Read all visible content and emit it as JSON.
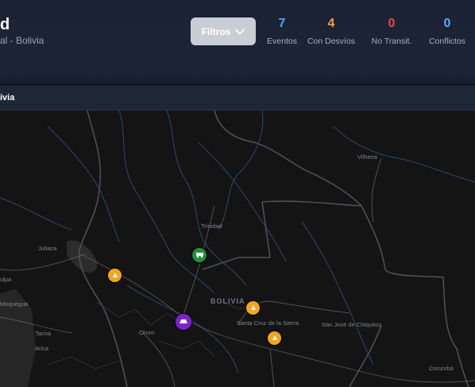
{
  "header": {
    "title_fragment": "d",
    "subtitle_fragment": "al - Bolivia",
    "filter_button": {
      "label": "Filtros",
      "icon": "chevron-down-icon"
    },
    "stats": [
      {
        "value": "7",
        "label": "Eventos",
        "color": "#4aa3ff"
      },
      {
        "value": "4",
        "label": "Con Desvíos",
        "color": "#f59e3b"
      },
      {
        "value": "0",
        "label": "No Transit.",
        "color": "#ef4444"
      },
      {
        "value": "0",
        "label": "Conflictos",
        "color": "#60a5fa"
      }
    ]
  },
  "map_section": {
    "label_fragment": "ivia"
  },
  "map": {
    "places": [
      {
        "name": "Vilhena"
      },
      {
        "name": "Trinidad"
      },
      {
        "name": "Juliaca"
      },
      {
        "name": "ulpa"
      },
      {
        "name": "Moquegua"
      },
      {
        "name": "Tacna"
      },
      {
        "name": "Arica"
      },
      {
        "name": "BOLIVIA"
      },
      {
        "name": "Santa Cruz de la Sierra"
      },
      {
        "name": "San José de Chiquitos"
      },
      {
        "name": "Oruro"
      },
      {
        "name": "Corumbá"
      }
    ],
    "markers": [
      {
        "type": "warning",
        "icon": "detour-icon",
        "color": "#f2a51e"
      },
      {
        "type": "works",
        "icon": "machinery-icon",
        "color": "#1f8f3a"
      },
      {
        "type": "warning",
        "icon": "detour-icon",
        "color": "#f2a51e"
      },
      {
        "type": "warning",
        "icon": "detour-icon",
        "color": "#f2a51e"
      },
      {
        "type": "incident",
        "icon": "vehicle-icon",
        "color": "#7e22ce"
      }
    ]
  }
}
